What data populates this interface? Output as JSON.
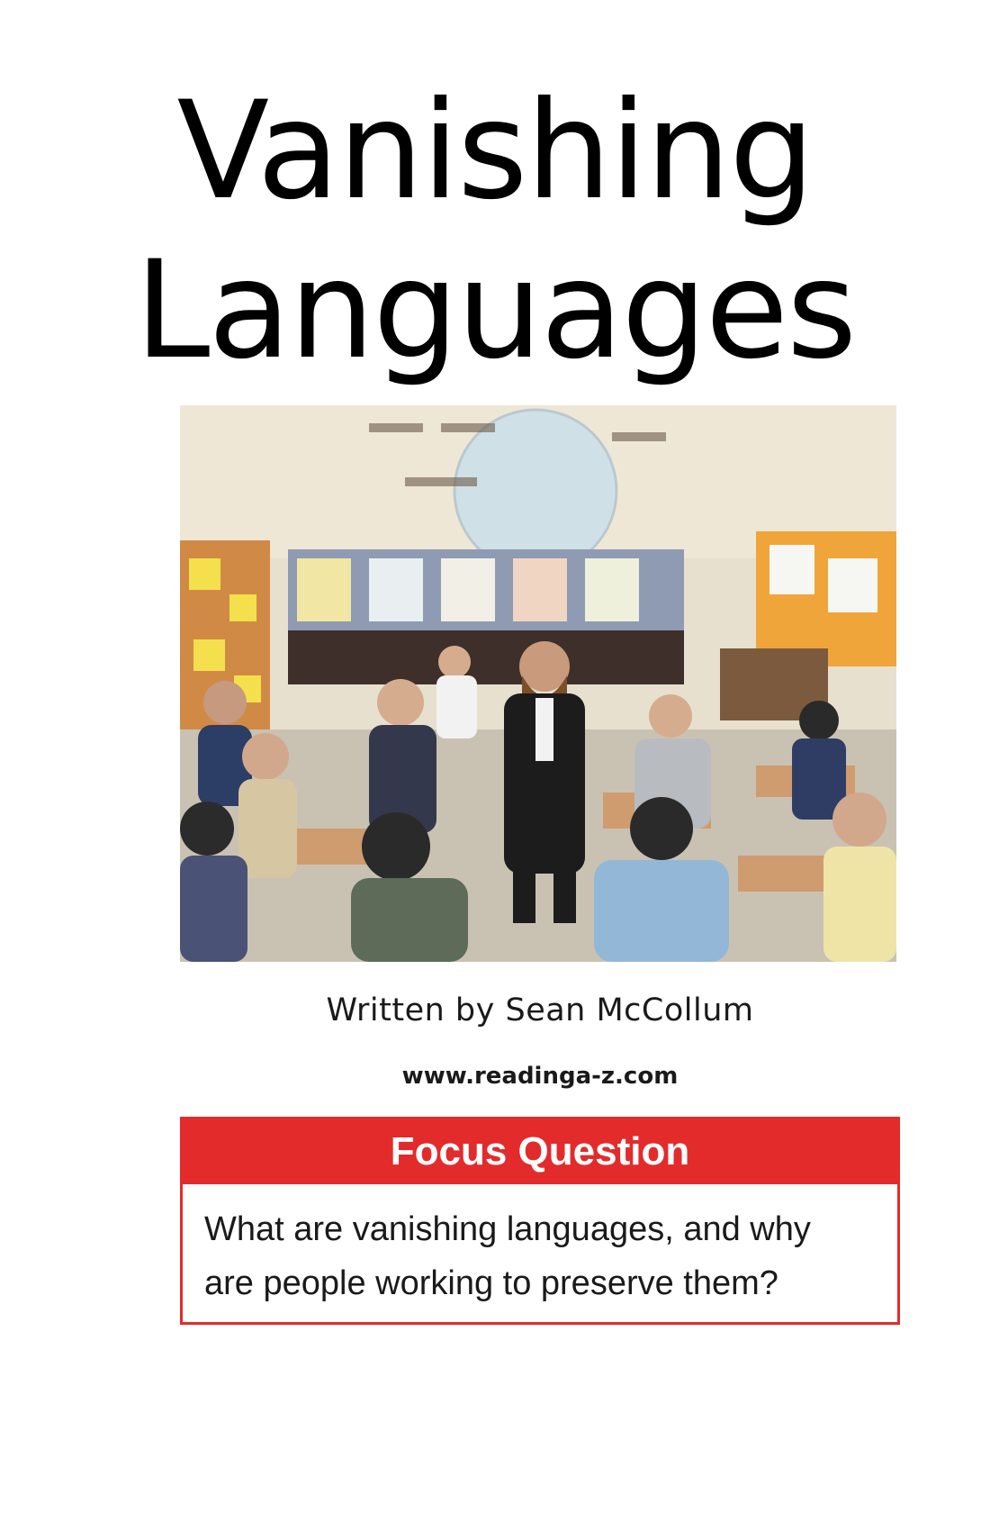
{
  "title": {
    "line1": "Vanishing",
    "line2": "Languages"
  },
  "photo": {
    "alt": "Classroom photo"
  },
  "byline": "Written by Sean McCollum",
  "url": "www.readinga-z.com",
  "focus": {
    "header": "Focus Question",
    "text": "What are vanishing languages, and why are people working to preserve them?"
  },
  "colors": {
    "accent": "#e32b2b"
  }
}
